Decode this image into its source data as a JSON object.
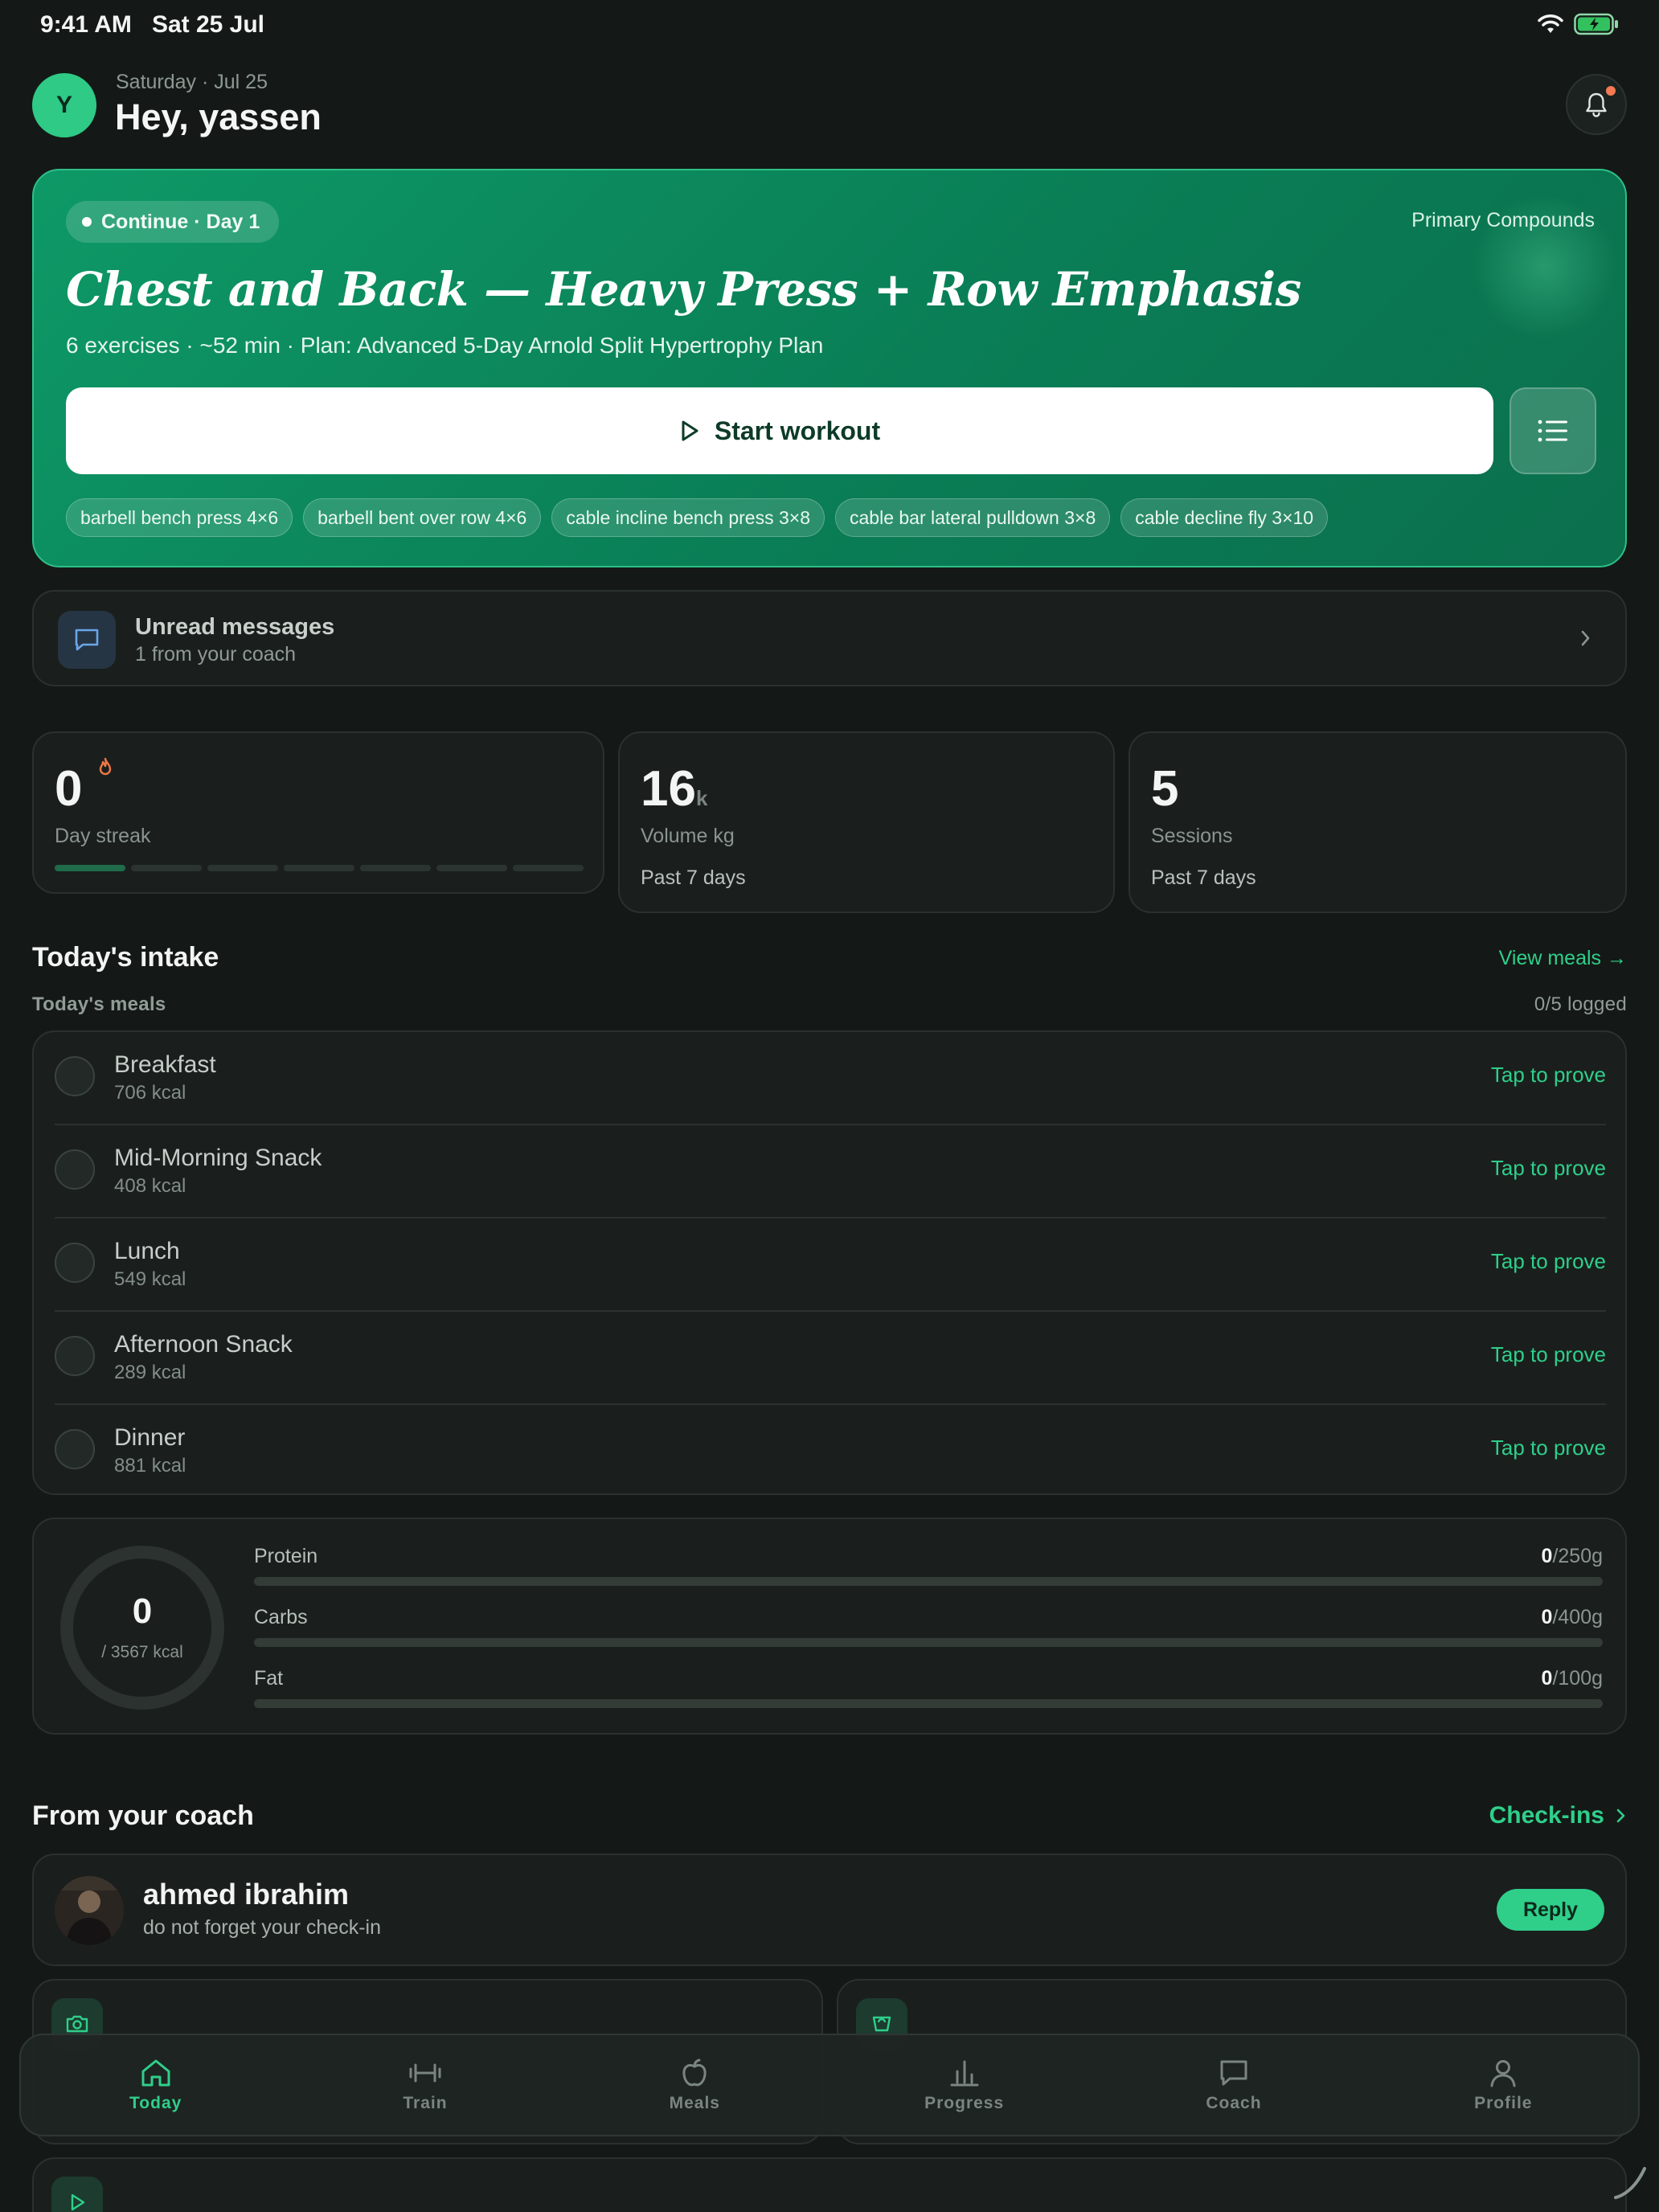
{
  "status_bar": {
    "time": "9:41 AM",
    "date": "Sat 25 Jul"
  },
  "header": {
    "avatar_initial": "Y",
    "date_line": "Saturday · Jul 25",
    "greeting": "Hey, yassen"
  },
  "hero": {
    "continue_label": "Continue · Day 1",
    "tag": "Primary Compounds",
    "title": "Chest and Back — Heavy Press + Row Emphasis",
    "subtitle": "6 exercises · ~52 min · Plan: Advanced 5-Day Arnold Split Hypertrophy Plan",
    "start_label": "Start workout",
    "chips": [
      "barbell bench press 4×6",
      "barbell bent over row 4×6",
      "cable incline bench press 3×8",
      "cable bar lateral pulldown 3×8",
      "cable decline fly 3×10"
    ]
  },
  "messages": {
    "title": "Unread messages",
    "subtitle": "1 from your coach"
  },
  "stats": {
    "streak": {
      "value": "0",
      "label": "Day streak",
      "days_done": 1,
      "days_total": 7
    },
    "volume": {
      "value": "16",
      "unit": "k",
      "label": "Volume kg",
      "footer": "Past 7 days"
    },
    "sessions": {
      "value": "5",
      "label": "Sessions",
      "footer": "Past 7 days"
    }
  },
  "intake": {
    "title": "Today's intake",
    "view_link": "View meals →",
    "meals_heading": "Today's meals",
    "logged": "0/5 logged",
    "meals": [
      {
        "name": "Breakfast",
        "kcal": "706 kcal",
        "action": "Tap to prove"
      },
      {
        "name": "Mid-Morning Snack",
        "kcal": "408 kcal",
        "action": "Tap to prove"
      },
      {
        "name": "Lunch",
        "kcal": "549 kcal",
        "action": "Tap to prove"
      },
      {
        "name": "Afternoon Snack",
        "kcal": "289 kcal",
        "action": "Tap to prove"
      },
      {
        "name": "Dinner",
        "kcal": "881 kcal",
        "action": "Tap to prove"
      }
    ],
    "calories": {
      "value": "0",
      "target": "/ 3567 kcal",
      "progress": 0
    },
    "macros": [
      {
        "label": "Protein",
        "value": "0",
        "target": "/250g",
        "progress": 0
      },
      {
        "label": "Carbs",
        "value": "0",
        "target": "/400g",
        "progress": 0
      },
      {
        "label": "Fat",
        "value": "0",
        "target": "/100g",
        "progress": 0
      }
    ]
  },
  "coach": {
    "title": "From your coach",
    "link": "Check-ins",
    "name": "ahmed ibrahim",
    "message": "do not forget your check-in",
    "reply_label": "Reply"
  },
  "tabs": [
    {
      "label": "Today",
      "icon": "home-icon",
      "active": true
    },
    {
      "label": "Train",
      "icon": "dumbbell-icon",
      "active": false
    },
    {
      "label": "Meals",
      "icon": "apple-icon",
      "active": false
    },
    {
      "label": "Progress",
      "icon": "bar-chart-icon",
      "active": false
    },
    {
      "label": "Coach",
      "icon": "chat-icon",
      "active": false
    },
    {
      "label": "Profile",
      "icon": "person-icon",
      "active": false
    }
  ],
  "colors": {
    "accent": "#2fcf8a",
    "hero_green": "#0a7e56",
    "background": "#141917"
  }
}
